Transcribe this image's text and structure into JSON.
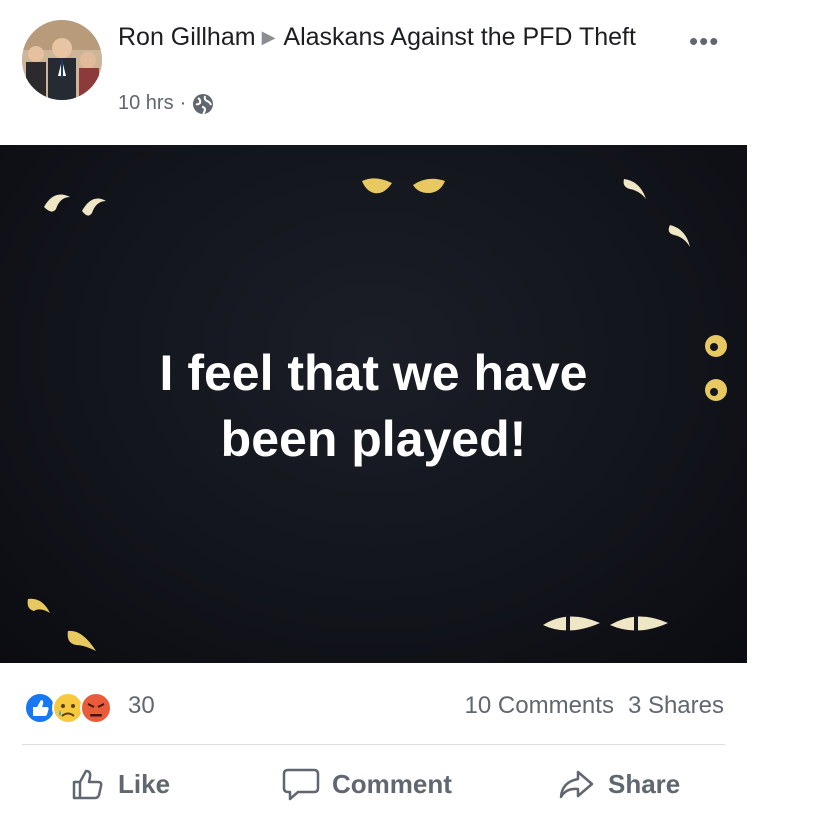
{
  "post": {
    "author": "Ron Gillham",
    "group_line": "Alaskans Against the PFD Theft",
    "time": "10 hrs",
    "audience_icon": "globe-icon",
    "more_icon": "more-options-icon",
    "more_symbol": "•••"
  },
  "image": {
    "caption_line1": "I feel that we have",
    "caption_line2": "been played!",
    "background": "#14161d",
    "eye_color": "#efe6c6",
    "eye_color_warm": "#e8c860"
  },
  "stats": {
    "reaction_icons": [
      "like-icon",
      "sad-icon",
      "angry-icon"
    ],
    "reaction_count": "30",
    "comments": "10 Comments",
    "shares": "3 Shares"
  },
  "actions": {
    "like": "Like",
    "comment": "Comment",
    "share": "Share"
  }
}
